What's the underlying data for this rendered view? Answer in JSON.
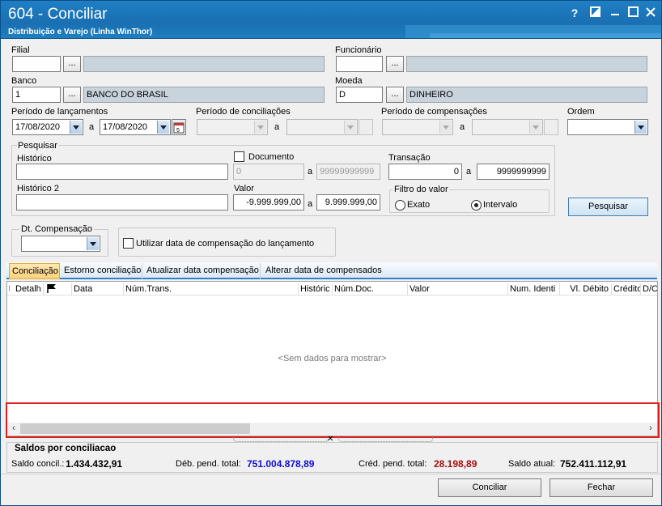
{
  "window": {
    "title": "604 - Conciliar",
    "subtitle": "Distribuição e Varejo (Linha WinThor)",
    "controls": {
      "help": "?",
      "restore": "◪",
      "minimize": "—",
      "maximize": "☐",
      "close": "✕"
    }
  },
  "form": {
    "filial": {
      "label": "Filial",
      "code": "",
      "name": ""
    },
    "funcionario": {
      "label": "Funcionário",
      "code": "",
      "name": ""
    },
    "banco": {
      "label": "Banco",
      "code": "1",
      "name": "BANCO DO BRASIL"
    },
    "moeda": {
      "label": "Moeda",
      "code": "D",
      "name": "DINHEIRO"
    },
    "dots": "...",
    "periodo_lanc": {
      "label": "Período de lançamentos",
      "from": "17/08/2020",
      "sep": "a",
      "to": "17/08/2020"
    },
    "periodo_conc": {
      "label": "Período de conciliações",
      "sep": "a"
    },
    "periodo_comp": {
      "label": "Período de compensações",
      "sep": "a"
    },
    "ordem": {
      "label": "Ordem",
      "value": ""
    }
  },
  "pesquisar": {
    "group_label": "Pesquisar",
    "historico_label": "Histórico",
    "historico2_label": "Histórico 2",
    "documento": {
      "label": "Documento",
      "checked": false,
      "from": "0",
      "sep": "a",
      "to": "99999999999"
    },
    "transacao": {
      "label": "Transação",
      "from": "0",
      "sep": "a",
      "to": "9999999999"
    },
    "valor": {
      "label": "Valor",
      "from": "-9.999.999,00",
      "sep": "a",
      "to": "9.999.999,00"
    },
    "filtro": {
      "label": "Filtro do valor",
      "exato": "Exato",
      "intervalo": "Intervalo",
      "selected": "Intervalo"
    },
    "button": "Pesquisar"
  },
  "dt_comp": {
    "label": "Dt. Compensação",
    "value": ""
  },
  "utilizar": {
    "label": "Utilizar data de compensação do lançamento",
    "checked": false
  },
  "tabs": [
    {
      "label": "Conciliação",
      "active": true
    },
    {
      "label": "Estorno conciliação"
    },
    {
      "label": "Atualizar data compensação"
    },
    {
      "label": "Alterar data de compensados"
    }
  ],
  "grid": {
    "columns": [
      "Detalh",
      "",
      "Data",
      "Núm.Trans.",
      "Históric",
      "Núm.Doc.",
      "Valor",
      "Num. Identi",
      "Vl. Débito",
      "Crédito",
      "D/C"
    ],
    "empty": "<Sem dados para mostrar>"
  },
  "saldos": {
    "title": "Saldos por conciliacao",
    "concil_label": "Saldo concil.:",
    "concil_value": "1.434.432,91",
    "deb_label": "Déb. pend. total:",
    "deb_value": "751.004.878,89",
    "cred_label": "Créd. pend. total:",
    "cred_value": "28.198,89",
    "atual_label": "Saldo atual:",
    "atual_value": "752.411.112,91"
  },
  "footer": {
    "conciliar": "Conciliar",
    "fechar": "Fechar"
  },
  "colors": {
    "title": "#1a6fb2",
    "debit": "#1010d0",
    "credit": "#a01010",
    "highlight": "#e02020"
  }
}
